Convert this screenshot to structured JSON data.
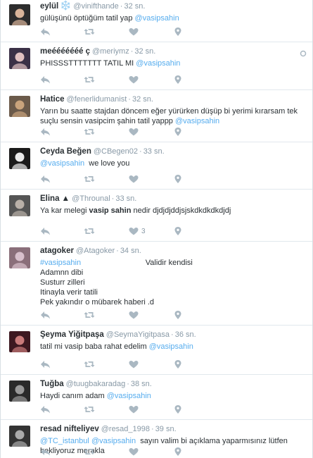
{
  "tweets": [
    {
      "name": "eylül",
      "handle": "@vinifthande",
      "time": "32 sn.",
      "icon": "snowflake-icon",
      "emoji": "❄️",
      "lines": [
        [
          {
            "t": "gülüşünü öptüğüm tatil yap "
          },
          {
            "t": "@vasipsahin",
            "c": "mention"
          }
        ]
      ]
    },
    {
      "name": "meééééééé ç",
      "handle": "@meriymz",
      "time": "32 sn.",
      "lines": [
        [
          {
            "t": "PHISSSTTTTTTT TATIL MI "
          },
          {
            "t": "@vasipsahin",
            "c": "mention"
          }
        ]
      ]
    },
    {
      "name": "Hatice",
      "handle": "@fenerlidumanist",
      "time": "32 sn.",
      "lines": [
        [
          {
            "t": "Yarın bu saatte stajdan döncem eğer yürürken düşüp bi yerimi kırarsam tek"
          }
        ],
        [
          {
            "t": "suçlu sensin vasipcim şahin tatil yappp "
          },
          {
            "t": "@vasipsahin",
            "c": "mention"
          }
        ]
      ]
    },
    {
      "name": "Ceyda Beğen",
      "handle": "@CBegen02",
      "time": "33 sn.",
      "lines": [
        [
          {
            "t": "@vasipsahin",
            "c": "mention"
          },
          {
            "t": "  we love you"
          }
        ]
      ]
    },
    {
      "name": "Elina ▲",
      "handle": "@Throunal",
      "time": "33 sn.",
      "like_count": "3",
      "lines": [
        [
          {
            "t": "Ya kar melegi "
          },
          {
            "t": "vasip sahin",
            "c": "bold"
          },
          {
            "t": " nedir djdjdjddjsjskdkdkdkdjdj"
          }
        ]
      ]
    },
    {
      "name": "atagoker",
      "handle": "@Atagoker",
      "time": "34 sn.",
      "lines": [
        [
          {
            "t": "#vasipsahin",
            "c": "mention"
          },
          {
            "t": "                              Validir kendisi"
          }
        ],
        [
          {
            "t": "Adamnn dibi"
          }
        ],
        [
          {
            "t": "Susturr zilleri"
          }
        ],
        [
          {
            "t": "Itinayla verir tatili"
          }
        ],
        [
          {
            "t": "Pek yakındır o mübarek haberi .d"
          }
        ]
      ]
    },
    {
      "name": "Şeyma Yiğitpaşa",
      "handle": "@SeymaYigitpasa",
      "time": "36 sn.",
      "lines": [
        [
          {
            "t": "tatil mi vasip baba rahat edelim "
          },
          {
            "t": "@vasipsahin",
            "c": "mention"
          }
        ]
      ]
    },
    {
      "name": "Tuğba",
      "handle": "@tuugbakaradag",
      "time": "38 sn.",
      "lines": [
        [
          {
            "t": "Haydi canım adam "
          },
          {
            "t": "@vasipsahin",
            "c": "mention"
          }
        ]
      ]
    },
    {
      "name": "resad nifteliyev",
      "handle": "@resad_1998",
      "time": "39 sn.",
      "lines": [
        [
          {
            "t": "@TC_istanbul",
            "c": "mention"
          },
          {
            "t": " "
          },
          {
            "t": "@vasipsahin",
            "c": "mention"
          },
          {
            "t": "  sayın valim bi açıklama yaparmısınız lütfen"
          }
        ],
        [
          {
            "t": "bekliyoruz merakla"
          }
        ]
      ]
    }
  ],
  "separator": "·",
  "colors": {
    "link": "#55acee",
    "name": "#292f33",
    "meta": "#8899a6",
    "text": "#292f33"
  }
}
